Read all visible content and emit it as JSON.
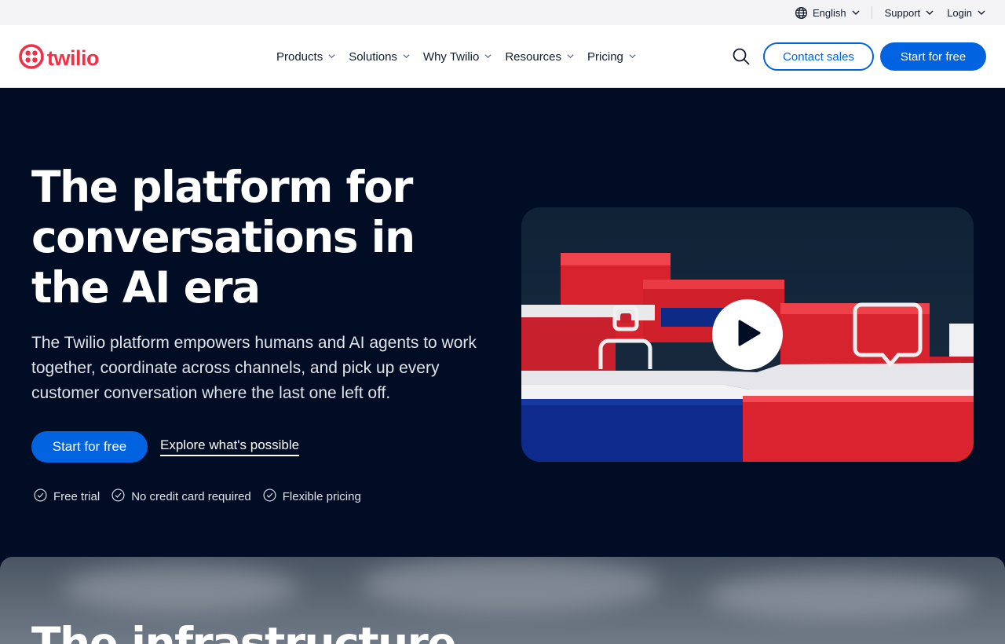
{
  "utility_bar": {
    "language": "English",
    "support": "Support",
    "login": "Login"
  },
  "nav": {
    "logo_text": "twilio",
    "menu": [
      {
        "label": "Products"
      },
      {
        "label": "Solutions"
      },
      {
        "label": "Why Twilio"
      },
      {
        "label": "Resources"
      },
      {
        "label": "Pricing"
      }
    ],
    "contact_sales": "Contact sales",
    "start_free": "Start for free"
  },
  "hero": {
    "title": "The platform for conversations in the AI era",
    "subtitle": "The Twilio platform empowers humans and AI agents to work together, coordinate across channels, and pick up every customer conversation where the last one left off.",
    "cta_primary": "Start for free",
    "cta_link": "Explore what's possible",
    "checks": [
      "Free trial",
      "No credit card required",
      "Flexible pricing"
    ]
  },
  "next_section": {
    "title": "The infrastructure"
  },
  "colors": {
    "brand_red": "#f22f46",
    "accent_blue": "#0263e0",
    "hero_bg": "#000d25"
  },
  "icons": {
    "globe": "globe-icon",
    "chevron": "chevron-down-icon",
    "search": "search-icon",
    "check": "check-circle-icon",
    "play": "play-icon"
  }
}
